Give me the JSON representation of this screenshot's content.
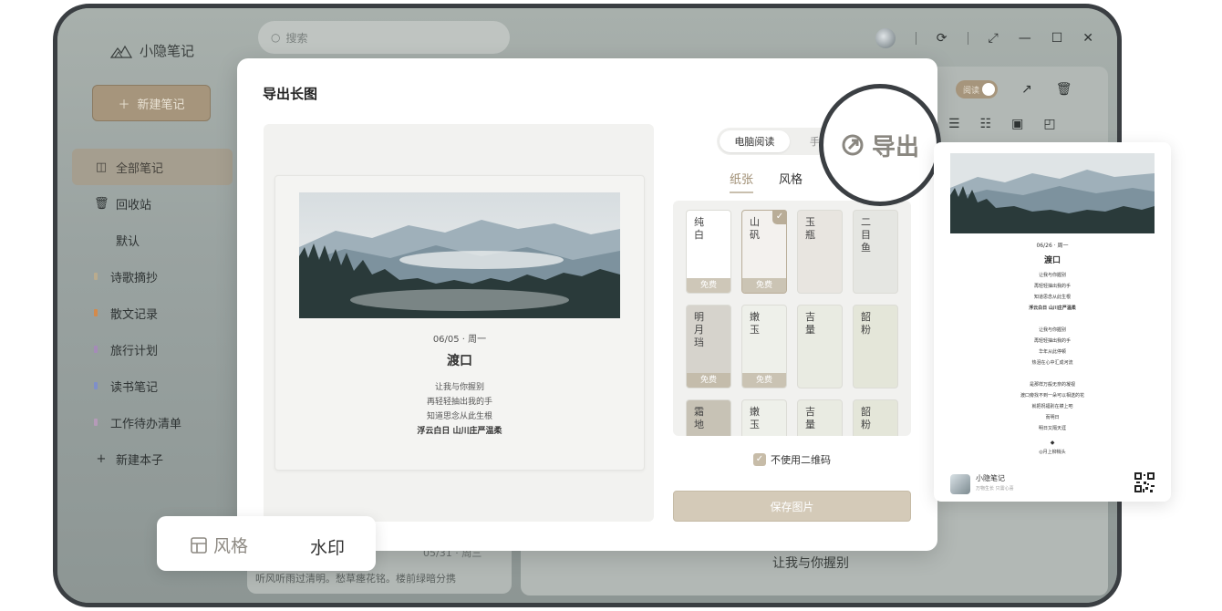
{
  "app": {
    "name": "小隐笔记"
  },
  "sidebar": {
    "new_note": "新建笔记",
    "items": [
      {
        "label": "全部笔记",
        "color": ""
      },
      {
        "label": "回收站",
        "color": ""
      },
      {
        "label": "默认",
        "color": ""
      },
      {
        "label": "诗歌摘抄",
        "color": "#b9ab8e"
      },
      {
        "label": "散文记录",
        "color": "#d48a4b"
      },
      {
        "label": "旅行计划",
        "color": "#a58bb8"
      },
      {
        "label": "读书笔记",
        "color": "#7f8fc9"
      },
      {
        "label": "工作待办清单",
        "color": "#b59ab8"
      }
    ],
    "new_notebook": "新建本子"
  },
  "search": {
    "placeholder": "搜索"
  },
  "background": {
    "read_label": "阅读",
    "note_date": "05/31 · 周三",
    "note_excerpt": "听风听雨过清明。愁草瘗花铭。楼前绿暗分携",
    "right_text": "让我与你握别"
  },
  "modal": {
    "title": "导出长图",
    "preview": {
      "date": "06/05 · 周一",
      "title": "渡口",
      "lines": [
        "让我与你握别",
        "再轻轻抽出我的手",
        "知道思念从此生根"
      ],
      "bold_line": "浮云白日 山川庄严温柔"
    },
    "mode_tabs": [
      "电脑阅读",
      "手"
    ],
    "sub_tabs": [
      "纸张",
      "风格"
    ],
    "papers": [
      {
        "name": "纯白",
        "free": "免费",
        "checked": false
      },
      {
        "name": "山矾",
        "free": "免费",
        "checked": true
      },
      {
        "name": "玉瓶",
        "free": "",
        "checked": false
      },
      {
        "name": "二目鱼",
        "free": "",
        "checked": false
      },
      {
        "name": "明月珰",
        "free": "免费",
        "checked": false
      },
      {
        "name": "嫩玉",
        "free": "免费",
        "checked": false
      },
      {
        "name": "吉量",
        "free": "",
        "checked": false
      },
      {
        "name": "韶粉",
        "free": "",
        "checked": false
      },
      {
        "name": "霜地",
        "free": "",
        "checked": false
      },
      {
        "name": "嫩玉",
        "free": "",
        "checked": false
      },
      {
        "name": "吉量",
        "free": "",
        "checked": false
      },
      {
        "name": "韶粉",
        "free": "",
        "checked": false
      }
    ],
    "no_qr": "不使用二维码",
    "save": "保存图片"
  },
  "magnifier": {
    "label": "导出"
  },
  "long_image": {
    "date": "06/26 · 周一",
    "title": "渡口",
    "stanza1": [
      "让我与你握别",
      "再轻轻抽出我的手",
      "知道思念从此生根"
    ],
    "stanza1_bold": "浮云白日 山川庄严温柔",
    "stanza2": [
      "让我与你握别",
      "再轻轻抽出我的手",
      "华年从此停顿",
      "热泪在心中汇成河流"
    ],
    "stanza3": [
      "是那样万般无奈的凝视",
      "渡口旁找不到一朵可以相送的花",
      "就把祝福别在襟上吧",
      "而明日",
      "明日又隔天涯"
    ],
    "sign": "◆",
    "sign_line": "◎月上柳梢头",
    "footer_name": "小隐笔记",
    "footer_sub": "万物生长 只需心喜"
  },
  "popup": {
    "style": "风格",
    "watermark": "水印"
  }
}
